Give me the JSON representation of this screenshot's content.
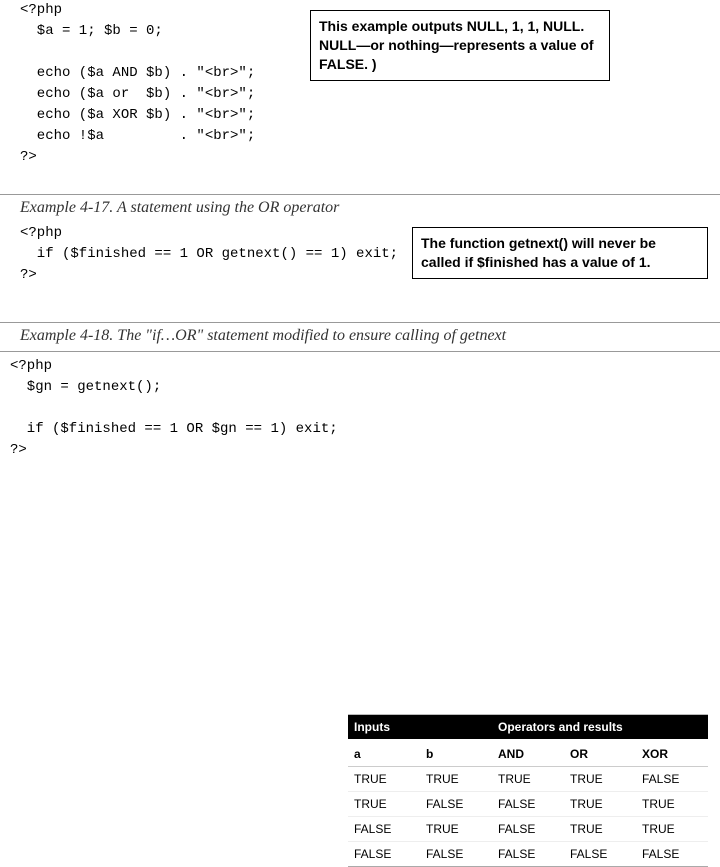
{
  "block1": {
    "code": "<?php\n  $a = 1; $b = 0;\n\n  echo ($a AND $b) . \"<br>\";\n  echo ($a or  $b) . \"<br>\";\n  echo ($a XOR $b) . \"<br>\";\n  echo !$a         . \"<br>\";\n?>",
    "annotation": "This example outputs NULL, 1, 1, NULL. NULL—or nothing—represents a value of FALSE. )"
  },
  "caption1": "Example 4-17. A statement using the OR operator",
  "block2": {
    "code": "<?php\n  if ($finished == 1 OR getnext() == 1) exit;\n?>",
    "annotation": "The function getnext() will never be called if $finished has a value of 1."
  },
  "caption2": "Example 4-18. The \"if…OR\" statement modified to ensure calling of getnext",
  "block3": {
    "code": "<?php\n  $gn = getnext();\n\n  if ($finished == 1 OR $gn == 1) exit;\n?>"
  },
  "truth_table": {
    "head_group1": "Inputs",
    "head_group2": "Operators and results",
    "cols": [
      "a",
      "b",
      "AND",
      "OR",
      "XOR"
    ],
    "rows": [
      [
        "TRUE",
        "TRUE",
        "TRUE",
        "TRUE",
        "FALSE"
      ],
      [
        "TRUE",
        "FALSE",
        "FALSE",
        "TRUE",
        "TRUE"
      ],
      [
        "FALSE",
        "TRUE",
        "FALSE",
        "TRUE",
        "TRUE"
      ],
      [
        "FALSE",
        "FALSE",
        "FALSE",
        "FALSE",
        "FALSE"
      ]
    ]
  }
}
